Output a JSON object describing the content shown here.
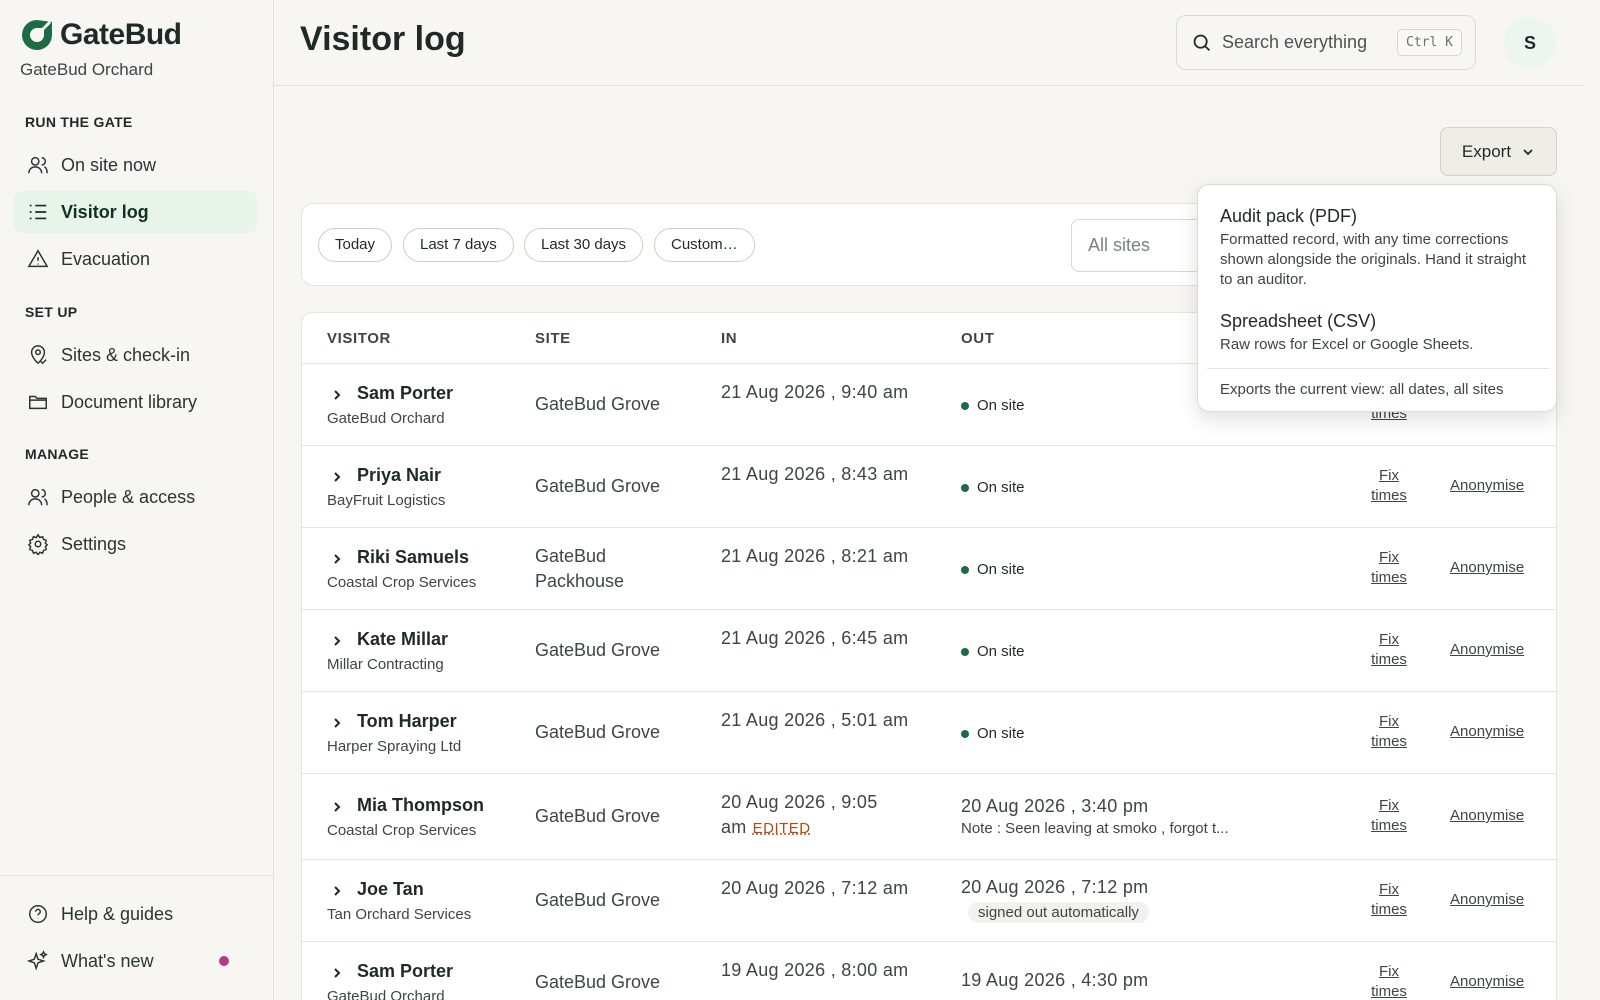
{
  "brand": {
    "name": "GateBud",
    "org": "GateBud Orchard"
  },
  "nav": {
    "sections": [
      "RUN THE GATE",
      "SET UP",
      "MANAGE"
    ],
    "items": [
      {
        "label": "On site now",
        "icon": "people-icon"
      },
      {
        "label": "Visitor log",
        "icon": "list-icon",
        "active": true
      },
      {
        "label": "Evacuation",
        "icon": "warning-icon"
      },
      {
        "label": "Sites & check-in",
        "icon": "location-pin-icon"
      },
      {
        "label": "Document library",
        "icon": "folder-icon"
      },
      {
        "label": "People & access",
        "icon": "people-icon"
      },
      {
        "label": "Settings",
        "icon": "gear-icon"
      }
    ],
    "bottom": [
      {
        "label": "Help & guides",
        "icon": "help-icon"
      },
      {
        "label": "What's new",
        "icon": "sparkle-icon"
      }
    ]
  },
  "header": {
    "title": "Visitor log",
    "search_placeholder": "Search everything",
    "search_shortcut": "Ctrl K",
    "avatar_initial": "S"
  },
  "export": {
    "label": "Export",
    "options": [
      {
        "title": "Audit pack (PDF)",
        "desc": "Formatted record, with any time corrections shown alongside the originals. Hand it straight to an auditor."
      },
      {
        "title": "Spreadsheet (CSV)",
        "desc": "Raw rows for Excel or Google Sheets."
      }
    ],
    "footer": "Exports the current view: all dates, all sites"
  },
  "filters": {
    "chips": [
      "Today",
      "Last 7 days",
      "Last 30 days",
      "Custom…"
    ],
    "site_placeholder": "All sites"
  },
  "table": {
    "columns": [
      "VISITOR",
      "SITE",
      "IN",
      "OUT"
    ],
    "fix_label": "Fix times",
    "anon_label": "Anonymise",
    "rows": [
      {
        "name": "Sam Porter",
        "org": "GateBud Orchard",
        "site": "GateBud Grove",
        "in": "21 Aug 2026 , 9:40 am",
        "status": "On site"
      },
      {
        "name": "Priya Nair",
        "org": "BayFruit Logistics",
        "site": "GateBud Grove",
        "in": "21 Aug 2026 , 8:43 am",
        "status": "On site"
      },
      {
        "name": "Riki Samuels",
        "org": "Coastal Crop Services",
        "site": "GateBud Packhouse",
        "in": "21 Aug 2026 , 8:21 am",
        "status": "On site"
      },
      {
        "name": "Kate Millar",
        "org": "Millar Contracting",
        "site": "GateBud Grove",
        "in": "21 Aug 2026 , 6:45 am",
        "status": "On site"
      },
      {
        "name": "Tom Harper",
        "org": "Harper Spraying Ltd",
        "site": "GateBud Grove",
        "in": "21 Aug 2026 , 5:01 am",
        "status": "On site"
      },
      {
        "name": "Mia Thompson",
        "org": "Coastal Crop Services",
        "site": "GateBud Grove",
        "in": "20 Aug 2026 , 9:05 am",
        "edited": "EDITED",
        "out": "20 Aug 2026 , 3:40 pm",
        "note": "Note : Seen leaving at smoko , forgot t..."
      },
      {
        "name": "Joe Tan",
        "org": "Tan Orchard Services",
        "site": "GateBud Grove",
        "in": "20 Aug 2026 , 7:12 am",
        "out": "20 Aug 2026 , 7:12 pm",
        "badge": "signed out automatically"
      },
      {
        "name": "Sam Porter",
        "org": "GateBud Orchard",
        "site": "GateBud Grove",
        "in": "19 Aug 2026 , 8:00 am",
        "out": "19 Aug 2026 , 4:30 pm"
      }
    ]
  },
  "colors": {
    "accent": "#1d6b45",
    "active_bg": "#e6f4ea",
    "edited": "#b14a12",
    "notification_dot": "#b5388c"
  }
}
